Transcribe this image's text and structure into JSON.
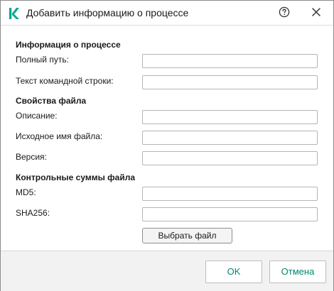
{
  "window": {
    "title": "Добавить информацию о процессе",
    "logo_icon": "kaspersky-k-logo",
    "help_icon": "question-circle-icon",
    "close_icon": "close-x-icon"
  },
  "process_info": {
    "heading": "Информация о процессе",
    "full_path_label": "Полный путь:",
    "full_path_value": "",
    "command_line_label": "Текст командной строки:",
    "command_line_value": ""
  },
  "file_properties": {
    "heading": "Свойства файла",
    "description_label": "Описание:",
    "description_value": "",
    "original_name_label": "Исходное имя файла:",
    "original_name_value": "",
    "version_label": "Версия:",
    "version_value": ""
  },
  "checksums": {
    "heading": "Контрольные суммы файла",
    "md5_label": "MD5:",
    "md5_value": "",
    "sha256_label": "SHA256:",
    "sha256_value": "",
    "select_file_label": "Выбрать файл"
  },
  "footer": {
    "ok_label": "OK",
    "cancel_label": "Отмена"
  },
  "colors": {
    "accent": "#00a88e",
    "button_text": "#00886e"
  }
}
